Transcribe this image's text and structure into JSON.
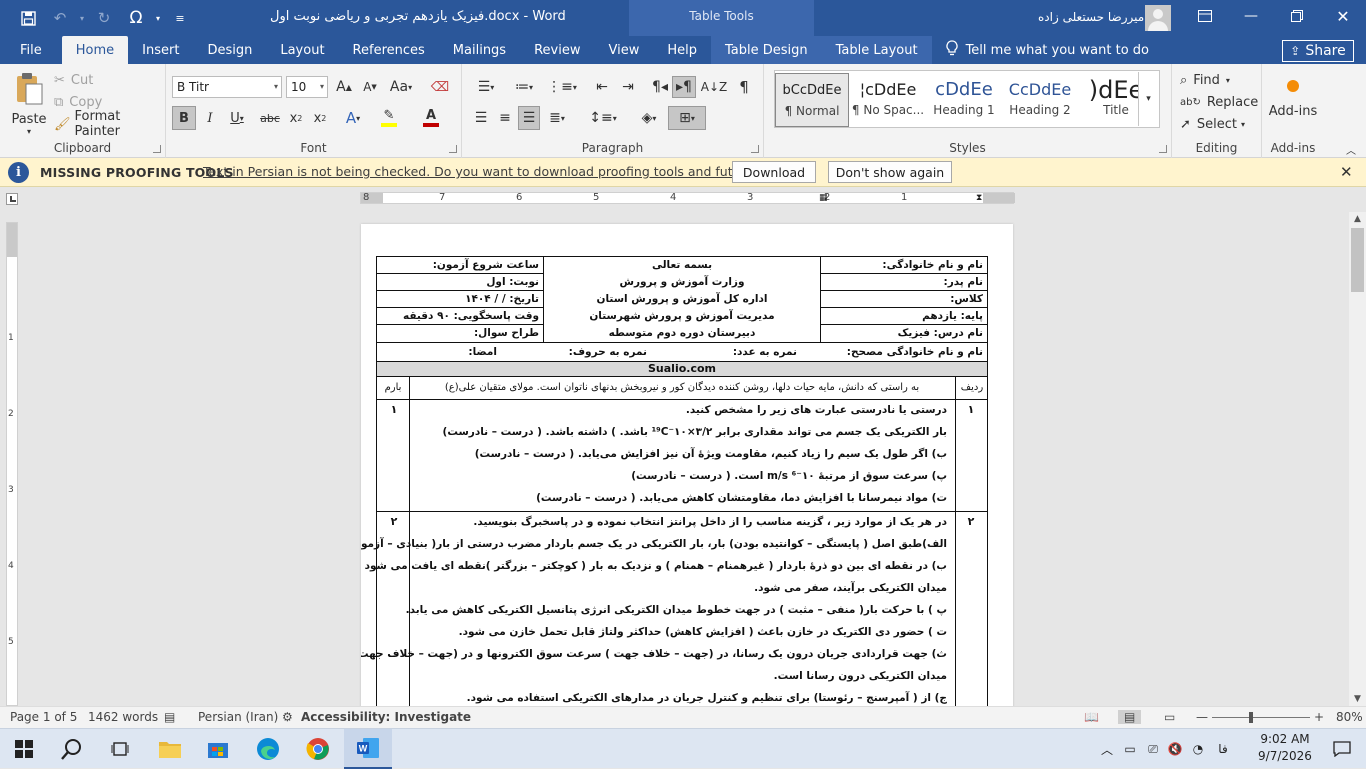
{
  "titlebar": {
    "document_title": "فیزیک یازدهم تجربی و ریاضی نوبت اول.docx - Word",
    "contextual_group": "Table Tools",
    "user_name": "امیررضا حستعلی زاده"
  },
  "tabs": {
    "file": "File",
    "home": "Home",
    "insert": "Insert",
    "design": "Design",
    "layout": "Layout",
    "references": "References",
    "mailings": "Mailings",
    "review": "Review",
    "view": "View",
    "help": "Help",
    "table_design": "Table Design",
    "table_layout": "Table Layout",
    "tell_me": "Tell me what you want to do",
    "share": "Share"
  },
  "ribbon": {
    "clipboard": {
      "paste": "Paste",
      "cut": "Cut",
      "copy": "Copy",
      "format_painter": "Format Painter",
      "label": "Clipboard"
    },
    "font": {
      "name": "B Titr",
      "size": "10",
      "label": "Font"
    },
    "paragraph": {
      "label": "Paragraph"
    },
    "styles": {
      "label": "Styles",
      "items": [
        {
          "preview": "bCcDdEe",
          "name": "¶ Normal"
        },
        {
          "preview": "¦cDdEe",
          "name": "¶ No Spac..."
        },
        {
          "preview": "cDdEe",
          "name": "Heading 1"
        },
        {
          "preview": "CcDdEe",
          "name": "Heading 2"
        },
        {
          "preview": ")dEe",
          "name": "Title"
        }
      ]
    },
    "editing": {
      "find": "Find",
      "replace": "Replace",
      "select": "Select",
      "label": "Editing"
    },
    "addins": {
      "button": "Add-ins",
      "label": "Add-ins"
    }
  },
  "message_bar": {
    "title": "MISSING PROOFING TOOLS",
    "text": "Text in Persian is not being checked. Do you want to download proofing tools and future updates?",
    "download": "Download",
    "dismiss": "Don't show again"
  },
  "ruler": {
    "numbers": [
      "8",
      "7",
      "6",
      "5",
      "4",
      "3",
      "2",
      "1"
    ]
  },
  "vruler": {
    "numbers": [
      "1",
      "2",
      "3",
      "4",
      "5"
    ]
  },
  "document": {
    "header": {
      "right": [
        "نام و نام خانوادگی:",
        "نام پدر:",
        "کلاس:",
        "پایه: یازدهم",
        "نام درس: فیزیک"
      ],
      "center": [
        "بسمه تعالی",
        "وزارت آموزش و پرورش",
        "اداره کل آموزش و پرورش استان",
        "مدیریت آموزش و پرورش شهرستان",
        "دبیرستان دوره دوم متوسطه"
      ],
      "left": [
        "ساعت شروع آزمون:",
        "نوبت: اول",
        "تاریخ:   /   /  ۱۴۰۴",
        "وقت پاسخگویی: ۹۰ دقیقه",
        "طراح سوال:"
      ],
      "bottom_corrector": "نام و نام خانوادگی مصحح:",
      "bottom_score_num": "نمره به عدد:",
      "bottom_score_text": "نمره به حروف:",
      "bottom_sign": "امضا:"
    },
    "site": "Sualio.com",
    "table_head": {
      "row": "ردیف",
      "quote": "به راستی که دانش، مایه حیات دلها، روشن کننده دیدگان کور و نیروبخش بدنهای ناتوان است. مولای متقیان علی(ع)",
      "score": "بارم"
    },
    "q1": {
      "num": "۱",
      "score": "۱",
      "lines": [
        "درستی یا نادرستی عبارت های زیر را مشخص کنید.",
        "بار الکتریکی یک جسم می تواند مقداری برابر ۳/۲×۱۰⁻¹⁹C باشد. ) داشته باشد. ( درست – نادرست)",
        "ب) اگر طول یک سیم را زیاد کنیم، مقاومت ویژهٔ آن نیز افزایش می‌یابد. ( درست – نادرست)",
        "پ) سرعت سوق از مرتبهٔ ۱۰⁻⁶ m/s است. ( درست – نادرست)",
        "ت) مواد نیمرسانا با افزایش دما، مقاومتشان کاهش می‌یابد. ( درست – نادرست)"
      ]
    },
    "q2": {
      "num": "۲",
      "score": "۲",
      "lines": [
        "در هر یک از موارد زیر ، گزینه مناسب را از داخل پرانتز انتخاب نموده و در پاسخبرگ بنویسید.",
        "الف)طبق اصل ( پایستگی – کوانتیده بودن) بار، بار الکتریکی در یک جسم باردار مضرب درستی از بار( بنیادی – آزمون) است.",
        "ب) در نقطه ای بین دو ذرهٔ باردار ( غیرهمنام – همنام ) و نزدیک به بار ( کوچکتر – بزرگتر )نقطه ای یافت می شود که در آن",
        "میدان الکتریکی برآیند، صفر می شود.",
        "پ ) با حرکت بار( منفی – مثبت ) در جهت خطوط میدان الکتریکی انرژی پتانسیل الکتریکی کاهش می یابد.",
        "ت ) حضور دی الکتریک در خازن باعث ( افزایش  کاهش) حداکثر ولتاژ قابل تحمل خازن می شود.",
        "ث) جهت قراردادی جریان درون یک رسانا، در (جهت – خلاف جهت ) سرعت سوق الکترونها و در (جهت – خلاف جهت )",
        "میدان الکتریکی درون رسانا است.",
        "ج) از ( آمپرسنج – رئوستا) برای تنظیم و کنترل جریان در مدارهای الکتریکی استفاده می شود."
      ]
    }
  },
  "status": {
    "page": "Page 1 of 5",
    "words": "1462 words",
    "language": "Persian (Iran)",
    "accessibility": "Accessibility: Investigate",
    "zoom": "80%",
    "zoom_level": 0.4
  },
  "taskbar": {
    "lang": "فا",
    "time": "9:02 AM",
    "date": "9/7/2026"
  },
  "colors": {
    "word_blue": "#2b579a",
    "message_bar": "#fff4ce",
    "font_color": "#c00000"
  }
}
